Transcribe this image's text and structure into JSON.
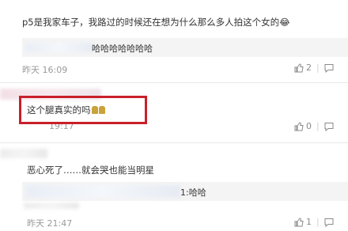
{
  "comments": [
    {
      "text": "p5是我家车子，我路过的时候还在想为什么那么多人拍这个女的😂",
      "reply_text": "哈哈哈哈哈哈哈",
      "time": "昨天 16:09",
      "likes": "2"
    },
    {
      "text": "这个腿真实的吗",
      "time": "19:17",
      "likes": "0"
    },
    {
      "text": "恶心死了……就会哭也能当明星",
      "reply_text": "1:哈哈",
      "time": "昨天 21:47",
      "likes": "1"
    }
  ],
  "colors": {
    "highlight": "#c8202a",
    "meta": "#9a9a9a"
  }
}
